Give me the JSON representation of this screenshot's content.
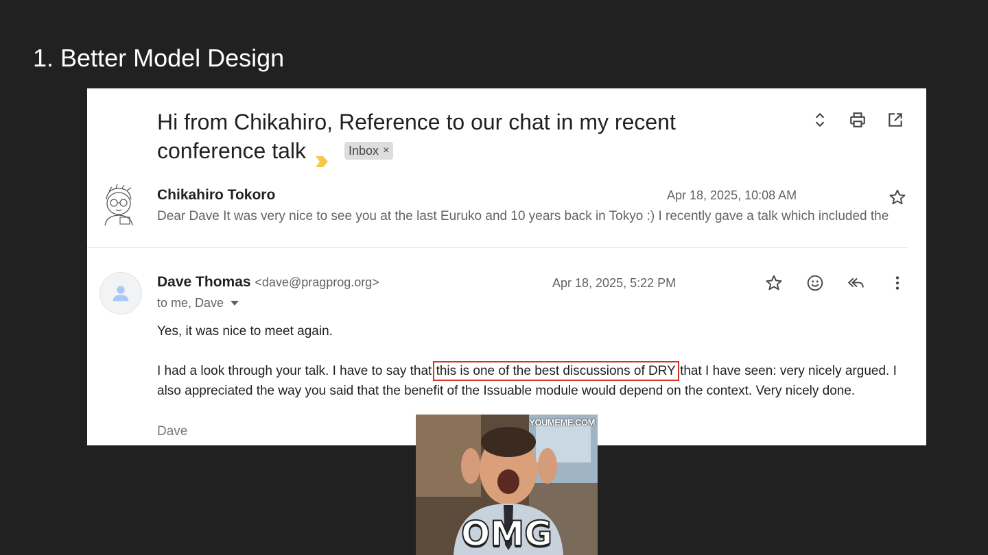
{
  "slide": {
    "title": "1. Better Model Design"
  },
  "thread": {
    "subject": "Hi from Chikahiro, Reference to our chat in my recent conference talk",
    "label": "Inbox",
    "label_remove": "×",
    "header_icons": [
      "expand-collapse-icon",
      "print-icon",
      "open-in-new-window-icon"
    ]
  },
  "message1": {
    "sender": "Chikahiro Tokoro",
    "date": "Apr 18, 2025, 10:08 AM",
    "snippet": "Dear Dave It was very nice to see you at the last Euruko and 10 years back in Tokyo :) I recently gave a talk which included the"
  },
  "message2": {
    "sender": "Dave Thomas",
    "email": "<dave@pragprog.org>",
    "date": "Apr 18, 2025, 5:22 PM",
    "to": "to me, Dave",
    "body_p1": "Yes, it was nice to meet again.",
    "body_p2_before": "I had a look through your talk. I have to say that ",
    "body_p2_highlight": "this is one of the best discussions of DRY",
    "body_p2_after": " that I have seen: very nicely argued. I also appreciated the way you said that the benefit of the Issuable module would depend on the context. Very nicely done.",
    "signature": "Dave",
    "action_icons": [
      "star-icon",
      "emoji-reaction-icon",
      "reply-all-icon",
      "more-options-icon"
    ]
  },
  "meme": {
    "watermark": "YOUMEME.COM",
    "caption": "OMG"
  },
  "colors": {
    "slide_bg": "#212121",
    "highlight_box": "#d93025",
    "importance_marker": "#f2c94c"
  }
}
